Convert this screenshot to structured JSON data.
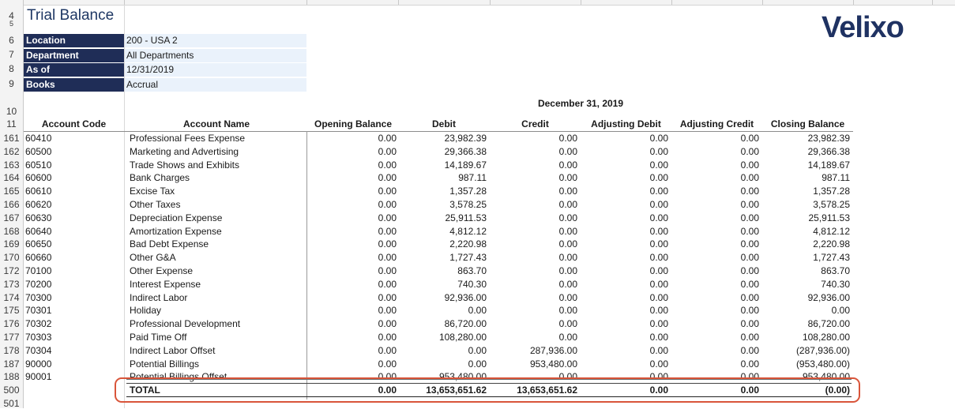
{
  "sheet": {
    "title": "Trial Balance",
    "brand": "Velixo",
    "parameters": [
      {
        "row": "6",
        "label": "Location",
        "value": "200 - USA 2"
      },
      {
        "row": "7",
        "label": "Department",
        "value": "All Departments"
      },
      {
        "row": "8",
        "label": "As of",
        "value": "12/31/2019"
      },
      {
        "row": "9",
        "label": "Books",
        "value": "Accrual"
      }
    ],
    "period_header": "December 31, 2019",
    "columns": {
      "account_code": "Account Code",
      "account_name": "Account Name",
      "opening": "Opening Balance",
      "debit": "Debit",
      "credit": "Credit",
      "adj_debit": "Adjusting Debit",
      "adj_credit": "Adjusting Credit",
      "closing": "Closing Balance"
    },
    "header_rows": {
      "r4": "4",
      "r5": "5",
      "r10": "10",
      "r11": "11"
    },
    "rows": [
      {
        "row": "161",
        "code": "60410",
        "name": "Professional Fees Expense",
        "opening": "0.00",
        "debit": "23,982.39",
        "credit": "0.00",
        "adj_debit": "0.00",
        "adj_credit": "0.00",
        "closing": "23,982.39"
      },
      {
        "row": "162",
        "code": "60500",
        "name": "Marketing and Advertising",
        "opening": "0.00",
        "debit": "29,366.38",
        "credit": "0.00",
        "adj_debit": "0.00",
        "adj_credit": "0.00",
        "closing": "29,366.38"
      },
      {
        "row": "163",
        "code": "60510",
        "name": "Trade Shows and Exhibits",
        "opening": "0.00",
        "debit": "14,189.67",
        "credit": "0.00",
        "adj_debit": "0.00",
        "adj_credit": "0.00",
        "closing": "14,189.67"
      },
      {
        "row": "164",
        "code": "60600",
        "name": "Bank Charges",
        "opening": "0.00",
        "debit": "987.11",
        "credit": "0.00",
        "adj_debit": "0.00",
        "adj_credit": "0.00",
        "closing": "987.11"
      },
      {
        "row": "165",
        "code": "60610",
        "name": "Excise Tax",
        "opening": "0.00",
        "debit": "1,357.28",
        "credit": "0.00",
        "adj_debit": "0.00",
        "adj_credit": "0.00",
        "closing": "1,357.28"
      },
      {
        "row": "166",
        "code": "60620",
        "name": "Other Taxes",
        "opening": "0.00",
        "debit": "3,578.25",
        "credit": "0.00",
        "adj_debit": "0.00",
        "adj_credit": "0.00",
        "closing": "3,578.25"
      },
      {
        "row": "167",
        "code": "60630",
        "name": "Depreciation Expense",
        "opening": "0.00",
        "debit": "25,911.53",
        "credit": "0.00",
        "adj_debit": "0.00",
        "adj_credit": "0.00",
        "closing": "25,911.53"
      },
      {
        "row": "168",
        "code": "60640",
        "name": "Amortization Expense",
        "opening": "0.00",
        "debit": "4,812.12",
        "credit": "0.00",
        "adj_debit": "0.00",
        "adj_credit": "0.00",
        "closing": "4,812.12"
      },
      {
        "row": "169",
        "code": "60650",
        "name": "Bad Debt Expense",
        "opening": "0.00",
        "debit": "2,220.98",
        "credit": "0.00",
        "adj_debit": "0.00",
        "adj_credit": "0.00",
        "closing": "2,220.98"
      },
      {
        "row": "170",
        "code": "60660",
        "name": "Other G&A",
        "opening": "0.00",
        "debit": "1,727.43",
        "credit": "0.00",
        "adj_debit": "0.00",
        "adj_credit": "0.00",
        "closing": "1,727.43"
      },
      {
        "row": "172",
        "code": "70100",
        "name": "Other Expense",
        "opening": "0.00",
        "debit": "863.70",
        "credit": "0.00",
        "adj_debit": "0.00",
        "adj_credit": "0.00",
        "closing": "863.70"
      },
      {
        "row": "173",
        "code": "70200",
        "name": "Interest Expense",
        "opening": "0.00",
        "debit": "740.30",
        "credit": "0.00",
        "adj_debit": "0.00",
        "adj_credit": "0.00",
        "closing": "740.30"
      },
      {
        "row": "174",
        "code": "70300",
        "name": "Indirect Labor",
        "opening": "0.00",
        "debit": "92,936.00",
        "credit": "0.00",
        "adj_debit": "0.00",
        "adj_credit": "0.00",
        "closing": "92,936.00"
      },
      {
        "row": "175",
        "code": "70301",
        "name": "Holiday",
        "opening": "0.00",
        "debit": "0.00",
        "credit": "0.00",
        "adj_debit": "0.00",
        "adj_credit": "0.00",
        "closing": "0.00"
      },
      {
        "row": "176",
        "code": "70302",
        "name": "Professional Development",
        "opening": "0.00",
        "debit": "86,720.00",
        "credit": "0.00",
        "adj_debit": "0.00",
        "adj_credit": "0.00",
        "closing": "86,720.00"
      },
      {
        "row": "177",
        "code": "70303",
        "name": "Paid Time Off",
        "opening": "0.00",
        "debit": "108,280.00",
        "credit": "0.00",
        "adj_debit": "0.00",
        "adj_credit": "0.00",
        "closing": "108,280.00"
      },
      {
        "row": "178",
        "code": "70304",
        "name": "Indirect Labor Offset",
        "opening": "0.00",
        "debit": "0.00",
        "credit": "287,936.00",
        "adj_debit": "0.00",
        "adj_credit": "0.00",
        "closing": "(287,936.00)"
      },
      {
        "row": "187",
        "code": "90000",
        "name": "Potential Billings",
        "opening": "0.00",
        "debit": "0.00",
        "credit": "953,480.00",
        "adj_debit": "0.00",
        "adj_credit": "0.00",
        "closing": "(953,480.00)"
      },
      {
        "row": "188",
        "code": "90001",
        "name": "Potential Billings Offset",
        "opening": "0.00",
        "debit": "953,480.00",
        "credit": "0.00",
        "adj_debit": "0.00",
        "adj_credit": "0.00",
        "closing": "953,480.00"
      }
    ],
    "total": {
      "row": "500",
      "label": "TOTAL",
      "opening": "0.00",
      "debit": "13,653,651.62",
      "credit": "13,653,651.62",
      "adj_debit": "0.00",
      "adj_credit": "0.00",
      "closing": "(0.00)"
    },
    "last_row": "501",
    "colors": {
      "label_bg": "#1f2d57",
      "value_bg": "#eaf2fb",
      "highlight": "#d9553a",
      "brand": "#1f3262"
    }
  }
}
